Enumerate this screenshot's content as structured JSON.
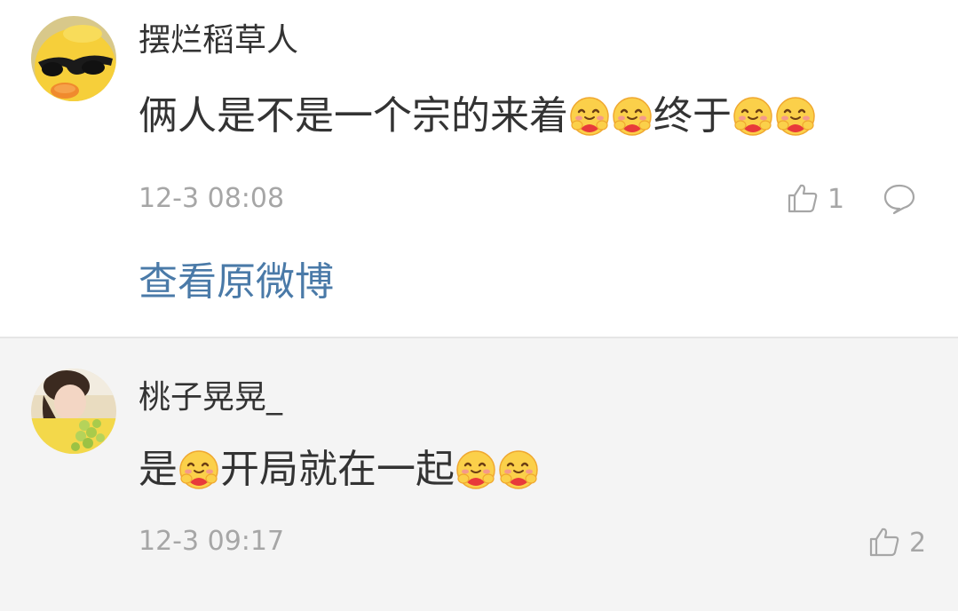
{
  "comments": [
    {
      "username": "摆烂稻草人",
      "content": {
        "part1": "俩人是不是一个宗的来着",
        "part2": "终于",
        "emoji": "hugging-face-emoji"
      },
      "timestamp": "12-3 08:08",
      "likes": "1",
      "avatar": "yellow-duck-with-sunglasses"
    },
    {
      "username": "桃子晃晃_",
      "content": {
        "part1": "是",
        "part2": "开局就在一起",
        "emoji": "hugging-face-emoji"
      },
      "timestamp": "12-3 09:17",
      "likes": "2",
      "avatar": "girl-with-grapes"
    }
  ],
  "view_original_label": "查看原微博",
  "icons": {
    "like": "thumbs-up-icon",
    "reply": "comment-bubble-icon"
  },
  "colors": {
    "link": "#4a7aa8",
    "meta": "#a6a6a6",
    "text": "#333333",
    "second_bg": "#f4f4f4"
  }
}
